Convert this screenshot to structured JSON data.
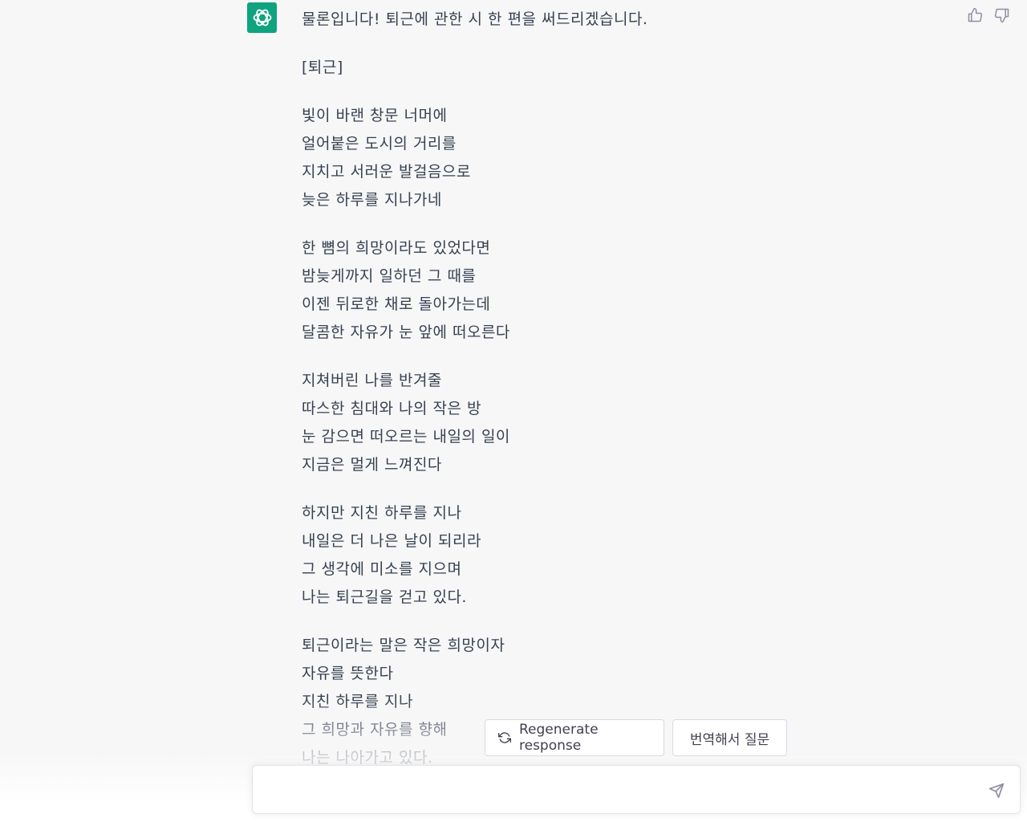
{
  "conversation": {
    "assistant_avatar_icon": "openai-logo-icon",
    "message": {
      "intro": "물론입니다! 퇴근에 관한 시 한 편을 써드리겠습니다.",
      "poem_title": "[퇴근]",
      "stanzas": [
        [
          "빛이 바랜 창문 너머에",
          "얼어붙은 도시의 거리를",
          "지치고 서러운 발걸음으로",
          "늦은 하루를 지나가네"
        ],
        [
          "한 뼘의 희망이라도 있었다면",
          "밤늦게까지 일하던 그 때를",
          "이젠 뒤로한 채로 돌아가는데",
          "달콤한 자유가 눈 앞에 떠오른다"
        ],
        [
          "지쳐버린 나를 반겨줄",
          "따스한 침대와 나의 작은 방",
          "눈 감으면 떠오르는 내일의 일이",
          "지금은 멀게 느껴진다"
        ],
        [
          "하지만 지친 하루를 지나",
          "내일은 더 나은 날이 되리라",
          "그 생각에 미소를 지으며",
          "나는 퇴근길을 걷고 있다."
        ],
        [
          "퇴근이라는 말은 작은 희망이자",
          "자유를 뜻한다",
          "지친 하루를 지나",
          "그 희망과 자유를 향해",
          "나는 나아가고 있다."
        ]
      ]
    },
    "feedback": {
      "thumbs_up_icon": "thumbs-up-icon",
      "thumbs_down_icon": "thumbs-down-icon"
    }
  },
  "actions": {
    "regenerate_label": "Regenerate response",
    "translate_label": "번역해서 질문"
  },
  "composer": {
    "value": "",
    "send_icon": "send-icon"
  },
  "colors": {
    "background": "#f7f7f8",
    "avatar": "#10a37f",
    "text": "#374151"
  }
}
